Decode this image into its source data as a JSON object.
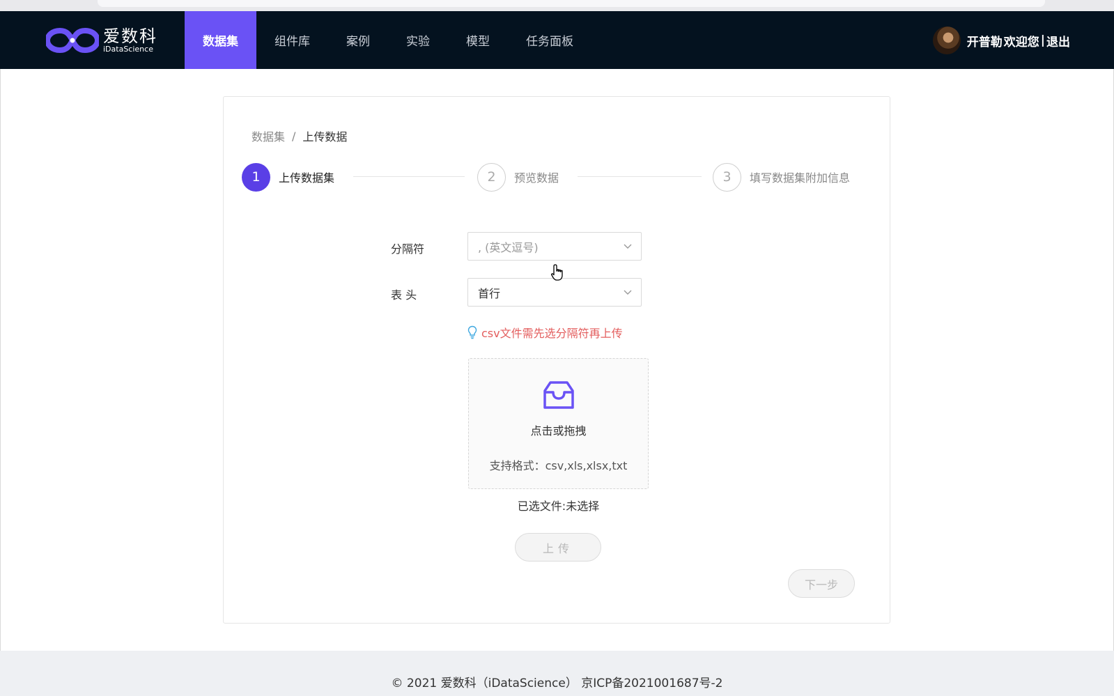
{
  "brand": {
    "name_cn": "爱数科",
    "name_en": "iDataScience"
  },
  "nav": {
    "items": [
      {
        "label": "数据集",
        "active": true
      },
      {
        "label": "组件库",
        "active": false
      },
      {
        "label": "案例",
        "active": false
      },
      {
        "label": "实验",
        "active": false
      },
      {
        "label": "模型",
        "active": false
      },
      {
        "label": "任务面板",
        "active": false
      }
    ]
  },
  "user": {
    "name": "开普勒",
    "welcome": "欢迎您",
    "divider": "|",
    "logout": "退出"
  },
  "breadcrumb": {
    "root": "数据集",
    "separator": "/",
    "current": "上传数据"
  },
  "steps": [
    {
      "number": "1",
      "label": "上传数据集",
      "active": true
    },
    {
      "number": "2",
      "label": "预览数据",
      "active": false
    },
    {
      "number": "3",
      "label": "填写数据集附加信息",
      "active": false
    }
  ],
  "form": {
    "delimiter": {
      "label": "分隔符",
      "placeholder": ", (英文逗号)"
    },
    "header": {
      "label": "表 头",
      "value": "首行"
    },
    "tip": "csv文件需先选分隔符再上传"
  },
  "dropzone": {
    "title": "点击或拖拽",
    "formats": "支持格式：csv,xls,xlsx,txt"
  },
  "selected_file": "已选文件:未选择",
  "buttons": {
    "upload": "上传",
    "next": "下一步"
  },
  "footer": {
    "text": "© 2021 爱数科（iDataScience） 京ICP备2021001687号-2"
  },
  "colors": {
    "topbar": "#04121f",
    "accent": "#6a52f5",
    "step_active": "#5a3fe6",
    "tip": "#e35d5d",
    "footer_bg": "#eef0f3"
  }
}
